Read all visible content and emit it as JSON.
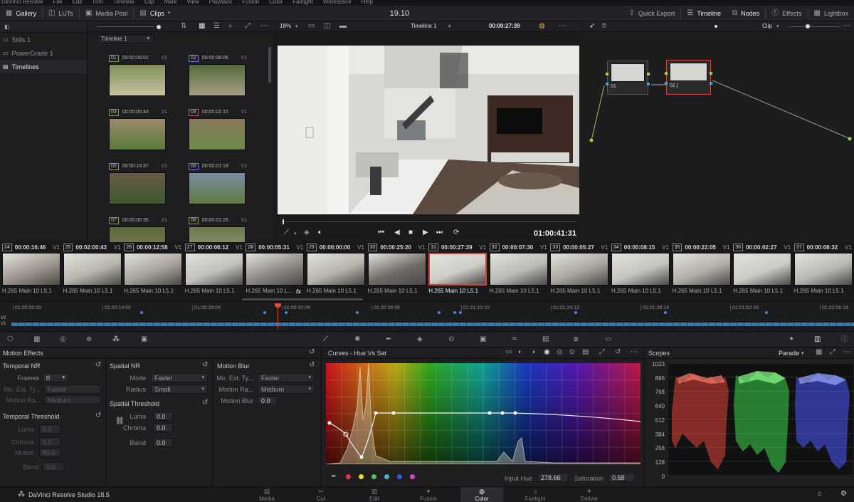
{
  "menubar": [
    "DaVinci Resolve",
    "File",
    "Edit",
    "Trim",
    "Timeline",
    "Clip",
    "Mark",
    "View",
    "Playback",
    "Fusion",
    "Color",
    "Fairlight",
    "Workspace",
    "Help"
  ],
  "toolbar": {
    "gallery": "Gallery",
    "luts": "LUTs",
    "media_pool": "Media Pool",
    "clips": "Clips",
    "project_title": "19.10",
    "quick_export": "Quick Export",
    "timeline": "Timeline",
    "nodes": "Nodes",
    "effects": "Effects",
    "lightbox": "Lightbox"
  },
  "gallery": {
    "items": [
      "Stills 1",
      "PowerGrade 1",
      "Timelines"
    ],
    "timeline_select": "Timeline 1"
  },
  "media_clips": [
    {
      "num": "01",
      "tc": "00:00:05:02",
      "track": "V1"
    },
    {
      "num": "02",
      "tc": "00:00:08:06",
      "track": "V1"
    },
    {
      "num": "03",
      "tc": "00:00:05:40",
      "track": "V1"
    },
    {
      "num": "04",
      "tc": "00:00:02:15",
      "track": "V1"
    },
    {
      "num": "05",
      "tc": "00:00:18:37",
      "track": "V1"
    },
    {
      "num": "06",
      "tc": "00:00:01:19",
      "track": "V1"
    },
    {
      "num": "07",
      "tc": "00:00:00:35",
      "track": "V1"
    },
    {
      "num": "08",
      "tc": "00:00:01:25",
      "track": "V1"
    }
  ],
  "viewer": {
    "zoom": "18%",
    "timeline_name": "Timeline 1",
    "duration_tc": "00:00:27:39",
    "playhead_tc": "01:00:41:31"
  },
  "nodes": {
    "mode": "Clip",
    "node1": "01",
    "node2": "02"
  },
  "timeline_clips": [
    {
      "num": "24",
      "tc": "00:00:16:46",
      "track": "V1",
      "name": "H.265 Main 10 L5.1"
    },
    {
      "num": "25",
      "tc": "00:02:00:43",
      "track": "V1",
      "name": "H.265 Main 10 L5.1"
    },
    {
      "num": "26",
      "tc": "00:00:12:58",
      "track": "V1",
      "name": "H.265 Main 10 L5.1"
    },
    {
      "num": "27",
      "tc": "00:00:06:12",
      "track": "V1",
      "name": "H.265 Main 10 L5.1"
    },
    {
      "num": "28",
      "tc": "00:00:05:31",
      "track": "V1",
      "name": "H.265 Main 10 L..."
    },
    {
      "num": "29",
      "tc": "00:00:00:00",
      "track": "V1",
      "name": "H.265 Main 10 L5.1"
    },
    {
      "num": "30",
      "tc": "00:00:25:20",
      "track": "V1",
      "name": "H.265 Main 10 L5.1"
    },
    {
      "num": "31",
      "tc": "00:00:27:39",
      "track": "V1",
      "name": "H.265 Main 10 L5.1"
    },
    {
      "num": "32",
      "tc": "00:00:07:30",
      "track": "V1",
      "name": "H.265 Main 10 L5.1"
    },
    {
      "num": "33",
      "tc": "00:00:05:27",
      "track": "V1",
      "name": "H.265 Main 10 L5.1"
    },
    {
      "num": "34",
      "tc": "00:00:08:15",
      "track": "V1",
      "name": "H.265 Main 10 L5.1"
    },
    {
      "num": "35",
      "tc": "00:00:22:05",
      "track": "V1",
      "name": "H.265 Main 10 L5.1"
    },
    {
      "num": "36",
      "tc": "00:00:02:27",
      "track": "V1",
      "name": "H.265 Main 10 L5.1"
    },
    {
      "num": "37",
      "tc": "00:00:08:32",
      "track": "V1",
      "name": "H.265 Main 10 L5.1"
    }
  ],
  "ruler": {
    "ticks": [
      "01:00:00:00",
      "01:00:14:02",
      "01:00:28:04",
      "01:00:42:06",
      "01:00:56:08",
      "01:01:10:10",
      "01:01:24:12",
      "01:01:38:14",
      "01:01:52:16",
      "01:02:06:18"
    ],
    "tracks": [
      "V2",
      "V1"
    ]
  },
  "motion_effects": {
    "title": "Motion Effects",
    "temporal_nr": "Temporal NR",
    "frames_label": "Frames",
    "frames_value": "0",
    "mo_est_type_label": "Mo. Est. Ty...",
    "mo_est_type_value": "Faster",
    "motion_range_label": "Motion Ra...",
    "motion_range_value": "Medium",
    "temporal_threshold": "Temporal Threshold",
    "luma_label": "Luma",
    "luma_value": "0.0",
    "chroma_label": "Chroma",
    "chroma_value": "0.0",
    "motion_label": "Motion",
    "motion_value": "50.0",
    "blend_label": "Blend",
    "blend_value": "0.0",
    "spatial_nr": "Spatial NR",
    "mode_label": "Mode",
    "mode_value": "Faster",
    "radius_label": "Radius",
    "radius_value": "Small",
    "spatial_threshold": "Spatial Threshold",
    "s_luma_label": "Luma",
    "s_luma_value": "0.0",
    "s_chroma_label": "Chroma",
    "s_chroma_value": "0.0",
    "s_blend_label": "Blend",
    "s_blend_value": "0.0",
    "motion_blur": "Motion Blur",
    "mb_type_label": "Mo. Est. Ty...",
    "mb_type_value": "Faster",
    "mb_range_label": "Motion Ra...",
    "mb_range_value": "Medium",
    "mb_blur_label": "Motion Blur",
    "mb_blur_value": "0.0"
  },
  "curves": {
    "title": "Curves - Hue Vs Sat",
    "input_hue_label": "Input Hue",
    "input_hue_value": "278.66",
    "saturation_label": "Saturation",
    "saturation_value": "0.58",
    "swatches": [
      "#e53c3c",
      "#e9d43a",
      "#52c74a",
      "#42b4d8",
      "#3558e8",
      "#c746c9"
    ]
  },
  "scopes": {
    "title": "Scopes",
    "mode": "Parade",
    "scale": [
      "1023",
      "896",
      "768",
      "640",
      "512",
      "384",
      "256",
      "128",
      "0"
    ]
  },
  "bottom": {
    "product": "DaVinci Resolve Studio 18.5",
    "pages": [
      "Media",
      "Cut",
      "Edit",
      "Fusion",
      "Color",
      "Fairlight",
      "Deliver"
    ],
    "active": "Color"
  }
}
